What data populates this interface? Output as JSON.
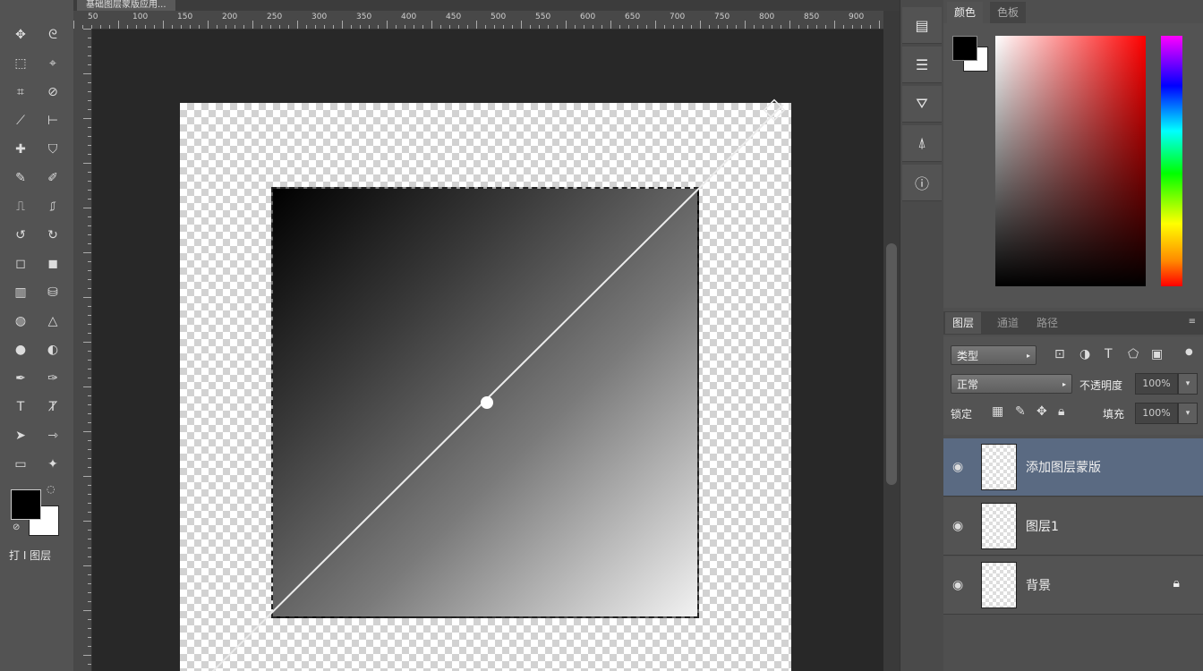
{
  "document_tab": {
    "title": "基础图层蒙版应用..."
  },
  "ruler_top": {
    "labels": [
      "50",
      "100",
      "150",
      "200",
      "250",
      "300",
      "350",
      "400",
      "450",
      "500",
      "550",
      "600",
      "650",
      "700",
      "750",
      "800",
      "850",
      "900"
    ]
  },
  "toolbar": {
    "tools": [
      {
        "name": "move-tool",
        "glyph": "✥"
      },
      {
        "name": "lasso-tool",
        "glyph": "ᘓ"
      },
      {
        "name": "marquee-tool",
        "glyph": "⬚"
      },
      {
        "name": "quick-select-tool",
        "glyph": "⌖"
      },
      {
        "name": "crop-tool",
        "glyph": "⌗"
      },
      {
        "name": "slice-tool",
        "glyph": "⊘"
      },
      {
        "name": "eyedropper-tool",
        "glyph": "⟋"
      },
      {
        "name": "ruler-tool",
        "glyph": "⊢"
      },
      {
        "name": "healing-tool",
        "glyph": "✚"
      },
      {
        "name": "patch-tool",
        "glyph": "⛉"
      },
      {
        "name": "brush-tool",
        "glyph": "✎"
      },
      {
        "name": "pencil-tool",
        "glyph": "✐"
      },
      {
        "name": "clone-stamp-tool",
        "glyph": "⎍"
      },
      {
        "name": "pattern-stamp-tool",
        "glyph": "⎎"
      },
      {
        "name": "history-brush-tool",
        "glyph": "↺"
      },
      {
        "name": "art-history-tool",
        "glyph": "↻"
      },
      {
        "name": "eraser-tool",
        "glyph": "◻"
      },
      {
        "name": "bg-eraser-tool",
        "glyph": "◼"
      },
      {
        "name": "gradient-tool",
        "glyph": "▥"
      },
      {
        "name": "paint-bucket-tool",
        "glyph": "⛁"
      },
      {
        "name": "blur-tool",
        "glyph": "◍"
      },
      {
        "name": "sharpen-tool",
        "glyph": "△"
      },
      {
        "name": "dodge-tool",
        "glyph": "●"
      },
      {
        "name": "burn-tool",
        "glyph": "◐"
      },
      {
        "name": "pen-tool",
        "glyph": "✒"
      },
      {
        "name": "freeform-pen-tool",
        "glyph": "✑"
      },
      {
        "name": "type-tool",
        "glyph": "T"
      },
      {
        "name": "vertical-type-tool",
        "glyph": "Ⱦ"
      },
      {
        "name": "path-select-tool",
        "glyph": "➤"
      },
      {
        "name": "direct-select-tool",
        "glyph": "⇾"
      },
      {
        "name": "shape-tool",
        "glyph": "▭"
      },
      {
        "name": "custom-shape-tool",
        "glyph": "✦"
      },
      {
        "name": "hand-tool",
        "glyph": "✋"
      },
      {
        "name": "rotate-view-tool",
        "glyph": "⟳"
      },
      {
        "name": "zoom-tool",
        "glyph": "⌕"
      },
      {
        "name": "extra-tool",
        "glyph": "…"
      }
    ],
    "quick_mask_label": "打 I 图层"
  },
  "mid_panel": {
    "buttons": [
      {
        "name": "history-panel-button",
        "glyph": "▤"
      },
      {
        "name": "properties-panel-button",
        "glyph": "☰"
      },
      {
        "name": "brush-panel-button",
        "glyph": "⛛"
      },
      {
        "name": "clone-source-panel-button",
        "glyph": "⍋"
      },
      {
        "name": "info-panel-button",
        "glyph": "ⓘ"
      }
    ]
  },
  "color_panel": {
    "tabs": [
      "颜色",
      "色板"
    ],
    "foreground": "#000000",
    "background": "#ffffff"
  },
  "layers_panel": {
    "tabs": [
      "图层",
      "通道",
      "路径"
    ],
    "filter_label": "类型",
    "blend_mode": "正常",
    "opacity_label": "不透明度",
    "opacity_value": "100%",
    "lock_label": "锁定",
    "fill_label": "填充",
    "fill_value": "100%",
    "layers": [
      {
        "name": "添加图层蒙版",
        "selected": true,
        "locked": false
      },
      {
        "name": "图层1",
        "selected": false,
        "locked": false
      },
      {
        "name": "背景",
        "selected": false,
        "locked": true
      }
    ]
  }
}
